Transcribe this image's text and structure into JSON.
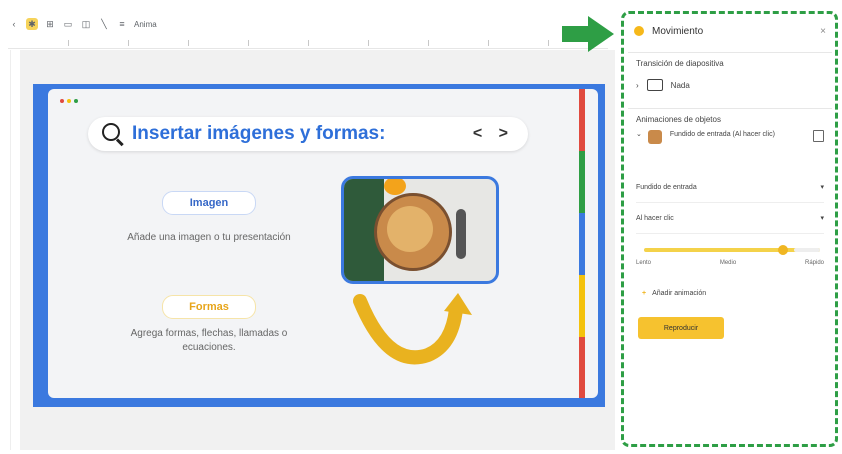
{
  "toolbar": {
    "mode_label": "Anima",
    "icons": [
      "cursor-icon",
      "select-icon",
      "image-icon",
      "shape-icon",
      "line-icon",
      "text-icon"
    ]
  },
  "slide": {
    "title": "Insertar imágenes y formas:",
    "nav": "< >",
    "images_pill": "Imagen",
    "images_desc": "Añade una imagen o tu presentación",
    "shapes_pill": "Formas",
    "shapes_desc": "Agrega formas, flechas, llamadas o ecuaciones.",
    "colors": {
      "frame": "#3b79df",
      "title": "#2e6fd9",
      "accent_yellow": "#e7a51a",
      "stripes": [
        "#e04a3f",
        "#2e9e45",
        "#3b79df",
        "#f4c20d",
        "#e04a3f"
      ]
    }
  },
  "panel": {
    "title": "Movimiento",
    "close": "×",
    "transition_section": "Transición de diapositiva",
    "transition_value": "Nada",
    "objects_section": "Animaciones de objetos",
    "object_anim_label": "Fundido de entrada (Al hacer clic)",
    "effect_dropdown": "Fundido de entrada",
    "trigger_dropdown": "Al hacer clic",
    "speed_labels": [
      "Lento",
      "Medio",
      "Rápido"
    ],
    "speed_value": 0.8,
    "add_animation": "Añadir animación",
    "play_button": "Reproducir"
  },
  "highlight_color": "#2e9e45"
}
